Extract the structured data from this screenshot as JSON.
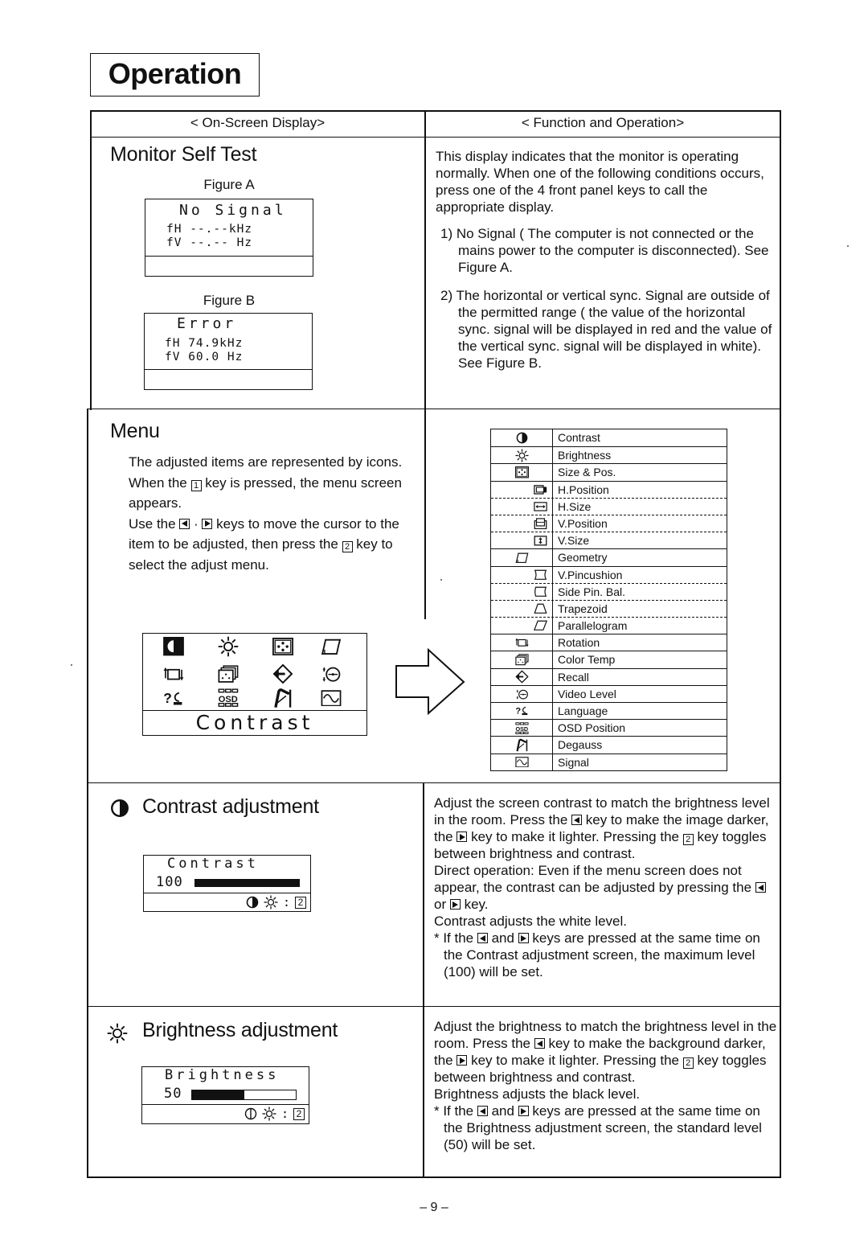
{
  "page": {
    "title": "Operation",
    "page_number": "– 9 –"
  },
  "headers": {
    "left": "< On-Screen Display>",
    "right": "< Function and Operation>"
  },
  "self_test": {
    "heading": "Monitor Self Test",
    "figure_a": {
      "caption": "Figure A",
      "title": "No Signal",
      "fh": "fH --.--kHz",
      "fv": "fV --.-- Hz"
    },
    "figure_b": {
      "caption": "Figure B",
      "title": "Error",
      "fh": "fH 74.9kHz",
      "fv": "fV 60.0 Hz"
    },
    "description": {
      "intro": "This display indicates that the monitor is operating normally. When one of the following conditions occurs, press one of the 4 front panel keys to call the appropriate display.",
      "item1": "1) No Signal ( The computer is not connected or the mains power to the computer is disconnected). See Figure A.",
      "item2": "2) The horizontal or vertical sync. Signal are outside of the permitted range ( the value of the horizontal sync. signal will be displayed in red and the value of the vertical sync. signal will be displayed in white). See Figure B."
    }
  },
  "menu": {
    "heading": "Menu",
    "text": {
      "l1": "The adjusted items are represented by icons.",
      "l2a": "When the ",
      "key1": "1",
      "l2b": " key is pressed, the menu screen appears.",
      "l3a": "Use the ",
      "l3sep": " · ",
      "l3b": " keys to move the cursor to the item to be adjusted, then press the ",
      "key2": "2",
      "l3c": " key to select the adjust menu."
    },
    "osd_selected_label": "Contrast",
    "osd_icons": [
      "contrast",
      "brightness",
      "size-pos",
      "geometry",
      "rotation",
      "color-temp",
      "recall",
      "video-level",
      "language",
      "osd-position",
      "degauss",
      "signal"
    ],
    "items": [
      {
        "icon": "contrast",
        "label": "Contrast",
        "sub": false
      },
      {
        "icon": "brightness",
        "label": "Brightness",
        "sub": false
      },
      {
        "icon": "size-pos",
        "label": "Size & Pos.",
        "sub": false
      },
      {
        "icon": "h-position",
        "label": "H.Position",
        "sub": true
      },
      {
        "icon": "h-size",
        "label": "H.Size",
        "sub": true
      },
      {
        "icon": "v-position",
        "label": "V.Position",
        "sub": true
      },
      {
        "icon": "v-size",
        "label": "V.Size",
        "sub": true
      },
      {
        "icon": "geometry",
        "label": "Geometry",
        "sub": false
      },
      {
        "icon": "v-pincushion",
        "label": "V.Pincushion",
        "sub": true
      },
      {
        "icon": "side-pin-bal",
        "label": "Side Pin. Bal.",
        "sub": true
      },
      {
        "icon": "trapezoid",
        "label": "Trapezoid",
        "sub": true
      },
      {
        "icon": "parallelogram",
        "label": "Parallelogram",
        "sub": true
      },
      {
        "icon": "rotation",
        "label": "Rotation",
        "sub": false
      },
      {
        "icon": "color-temp",
        "label": "Color Temp",
        "sub": false
      },
      {
        "icon": "recall",
        "label": "Recall",
        "sub": false
      },
      {
        "icon": "video-level",
        "label": "Video Level",
        "sub": false
      },
      {
        "icon": "language",
        "label": "Language",
        "sub": false
      },
      {
        "icon": "osd-position",
        "label": "OSD Position",
        "sub": false
      },
      {
        "icon": "degauss",
        "label": "Degauss",
        "sub": false
      },
      {
        "icon": "signal",
        "label": "Signal",
        "sub": false
      }
    ]
  },
  "contrast": {
    "heading": "Contrast adjustment",
    "osd_title": "Contrast",
    "value": "100",
    "level": 100,
    "max": 100,
    "footer_key": "2",
    "footer_sep": ":",
    "text": {
      "p1a": "Adjust the screen contrast to match the brightness level in the room. Press the ",
      "p1b": " key to make the image darker, the ",
      "p1c": " key to make it lighter. Pressing the ",
      "key2": "2",
      "p1d": " key toggles between brightness and contrast.",
      "p2a": "Direct operation: Even if the menu screen does not appear, the contrast can be adjusted by pressing the ",
      "p2b": " or ",
      "p2c": " key.",
      "p3": "Contrast adjusts the white level.",
      "p4a": "* If the ",
      "p4b": "  and ",
      "p4c": " keys are pressed at the same time on the Contrast adjustment screen, the maximum level (100) will be set."
    }
  },
  "brightness": {
    "heading": "Brightness adjustment",
    "osd_title": "Brightness",
    "value": "50",
    "level": 50,
    "max": 100,
    "footer_key": "2",
    "footer_sep": ":",
    "text": {
      "p1a": "Adjust the brightness to match the brightness level in the room. Press the ",
      "p1b": " key to make the background darker, the ",
      "p1c": " key to make it lighter. Pressing the ",
      "key2": "2",
      "p1d": " key toggles between brightness and contrast.",
      "p2": "Brightness adjusts the black level.",
      "p3a": "* If the ",
      "p3b": " and ",
      "p3c": " keys are pressed at the same time on the Brightness adjustment screen, the standard level (50) will be set."
    }
  }
}
